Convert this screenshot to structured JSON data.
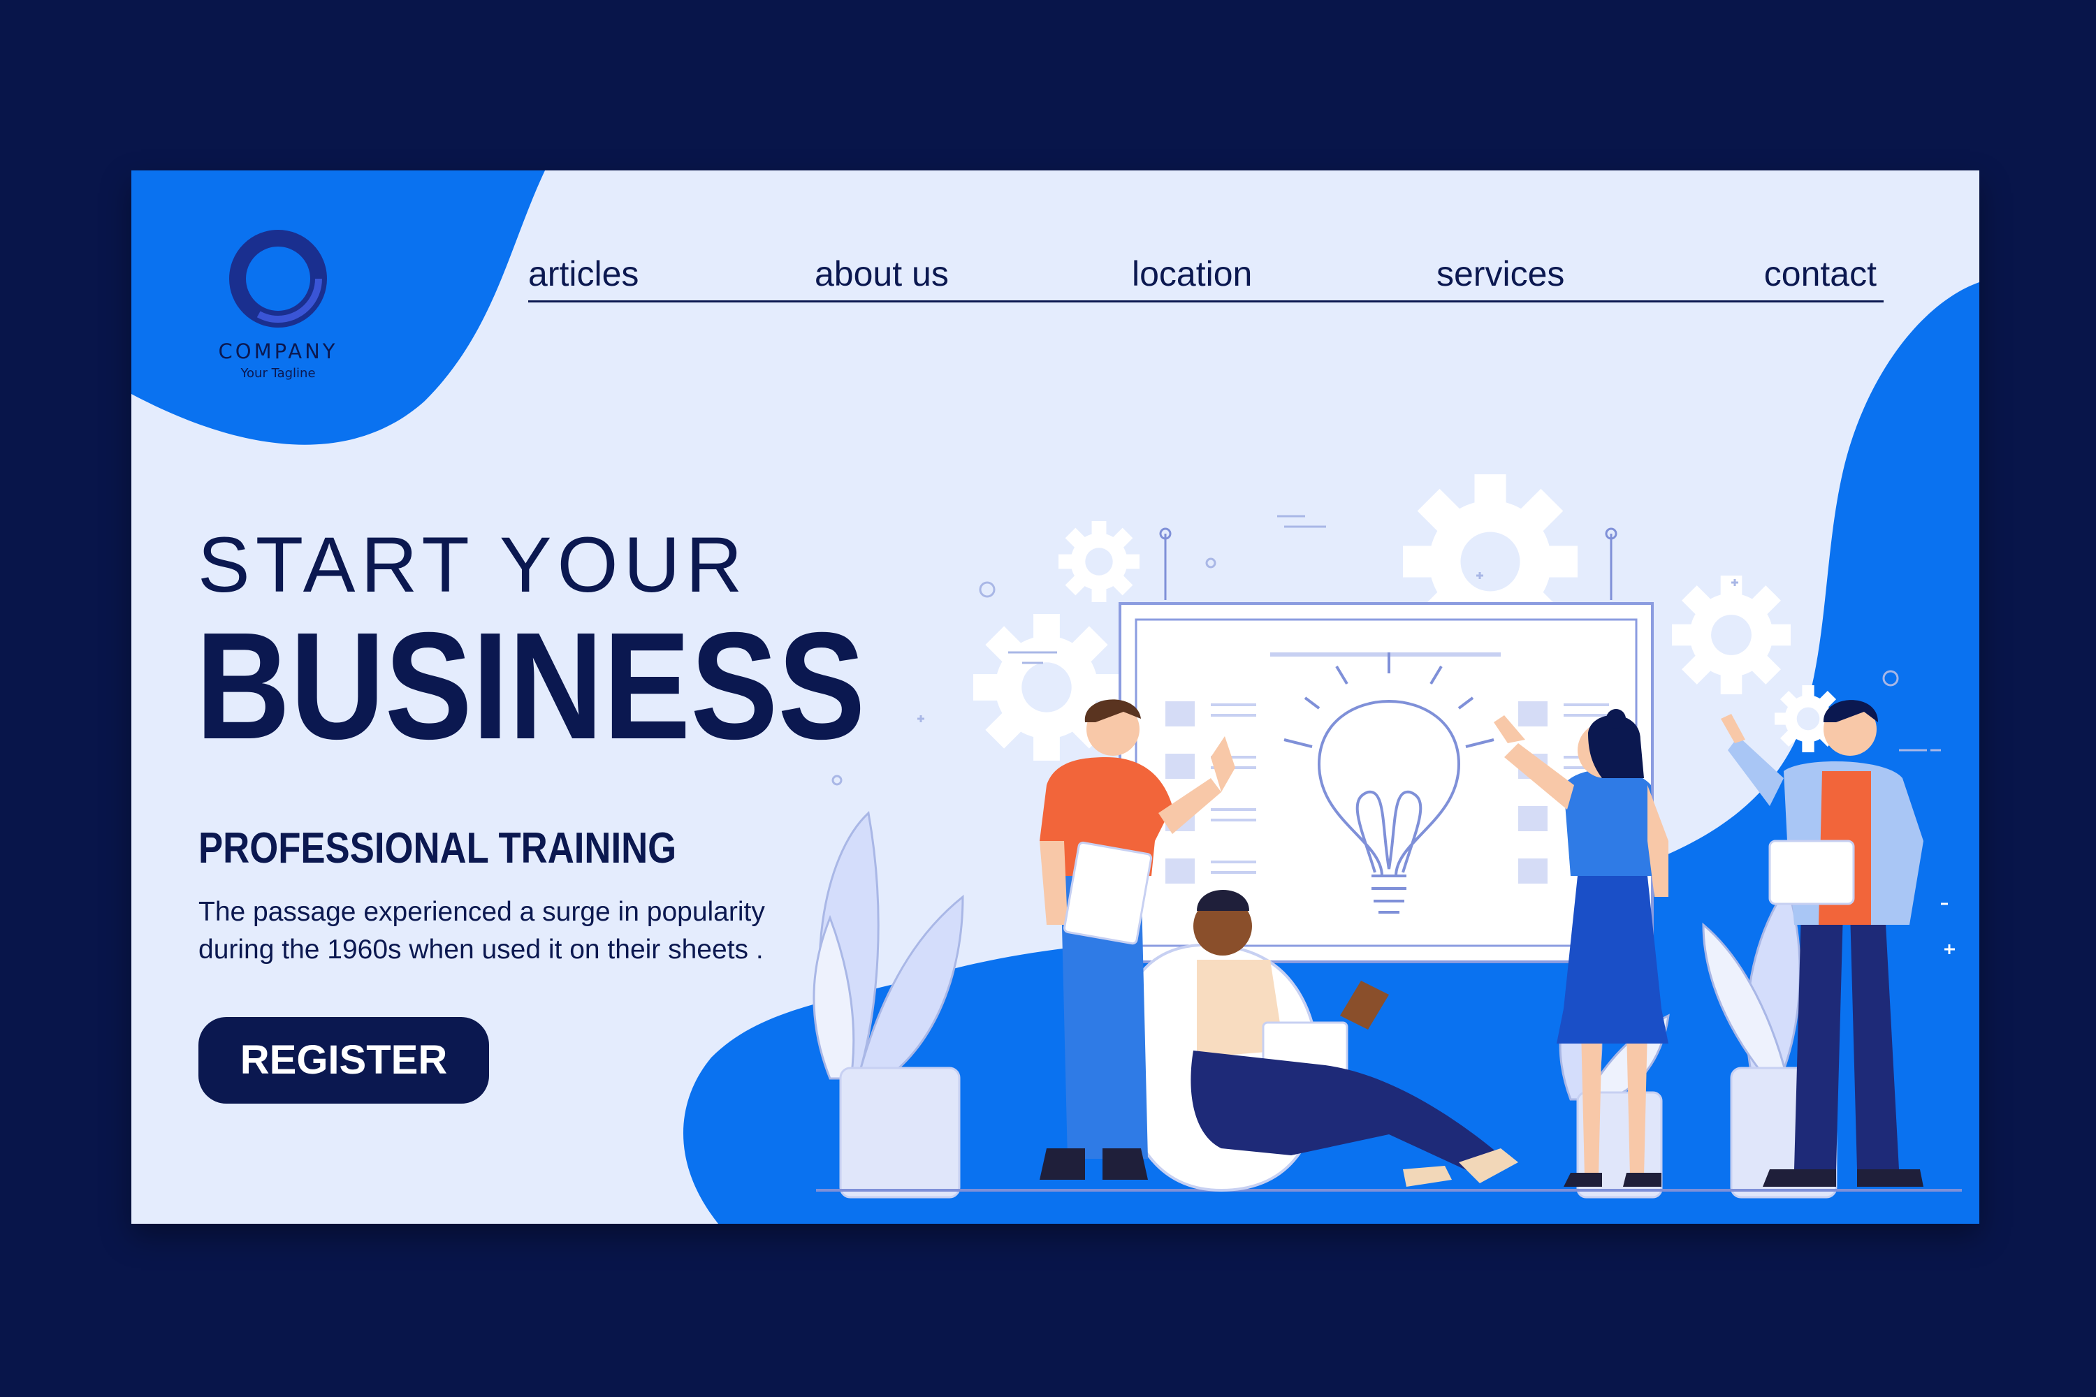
{
  "brand": {
    "name": "COMPANY",
    "tagline": "Your Tagline"
  },
  "nav": {
    "items": [
      {
        "label": "articles"
      },
      {
        "label": "about us"
      },
      {
        "label": "location"
      },
      {
        "label": "services"
      },
      {
        "label": "contact"
      }
    ]
  },
  "hero": {
    "pretitle": "START YOUR",
    "title": "BUSINESS",
    "subtitle": "PROFESSIONAL TRAINING",
    "description": "The passage experienced a surge in popularity during the 1960s when used it on their sheets .",
    "cta_label": "REGISTER"
  },
  "colors": {
    "page_background": "#08154a",
    "card_background": "#e4ecfd",
    "accent_blue": "#0a72f0",
    "navy": "#0b1850",
    "orange": "#f2653a"
  }
}
